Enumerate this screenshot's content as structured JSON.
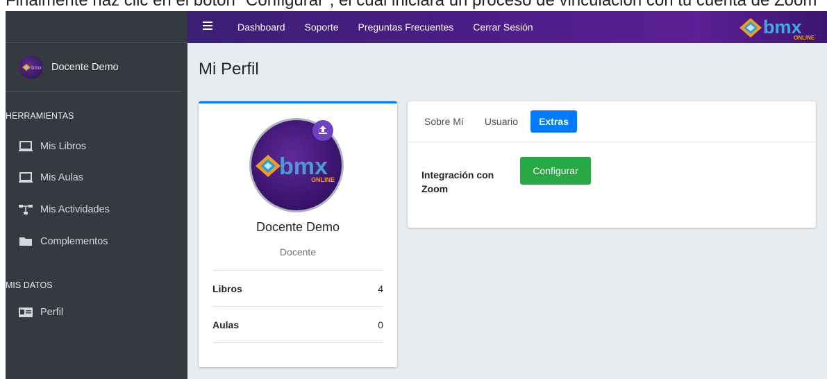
{
  "caption": {
    "text": "Finalmente haz clic en el botón \"Configurar\", el cual iniciará un proceso de vinculación con tu cuenta de Zoom"
  },
  "topbar": {
    "menu_icon": "hamburger-icon",
    "nav": [
      {
        "label": "Dashboard"
      },
      {
        "label": "Soporte"
      },
      {
        "label": "Preguntas Frecuentes"
      },
      {
        "label": "Cerrar Sesión"
      }
    ],
    "logo": {
      "text": "bmx",
      "sub": "ONLINE"
    }
  },
  "sidebar": {
    "user_name": "Docente Demo",
    "sections": [
      {
        "header": "HERRAMIENTAS",
        "items": [
          {
            "label": "Mis Libros",
            "icon": "laptop-icon"
          },
          {
            "label": "Mis Aulas",
            "icon": "laptop-icon"
          },
          {
            "label": "Mis Actividades",
            "icon": "sitemap-icon"
          },
          {
            "label": "Complementos",
            "icon": "folder-icon"
          }
        ]
      },
      {
        "header": "MIS DATOS",
        "items": [
          {
            "label": "Perfil",
            "icon": "id-card-icon"
          }
        ]
      }
    ]
  },
  "main": {
    "page_title": "Mi Perfil",
    "profile": {
      "name": "Docente Demo",
      "role": "Docente",
      "avatar_text": "bmx",
      "avatar_sub": "ONLINE",
      "stats": [
        {
          "label": "Libros",
          "value": "4"
        },
        {
          "label": "Aulas",
          "value": "0"
        }
      ]
    },
    "tabs": [
      {
        "label": "Sobre Mí",
        "active": false
      },
      {
        "label": "Usuario",
        "active": false
      },
      {
        "label": "Extras",
        "active": true
      }
    ],
    "extras": {
      "zoom_label": "Integración con Zoom",
      "config_button": "Configurar"
    }
  },
  "colors": {
    "sidebar_bg": "#343a40",
    "topbar_start": "#3a1f73",
    "topbar_end": "#5c1f95",
    "primary": "#007bff",
    "success": "#28a745",
    "content_bg": "#e9ecef"
  }
}
